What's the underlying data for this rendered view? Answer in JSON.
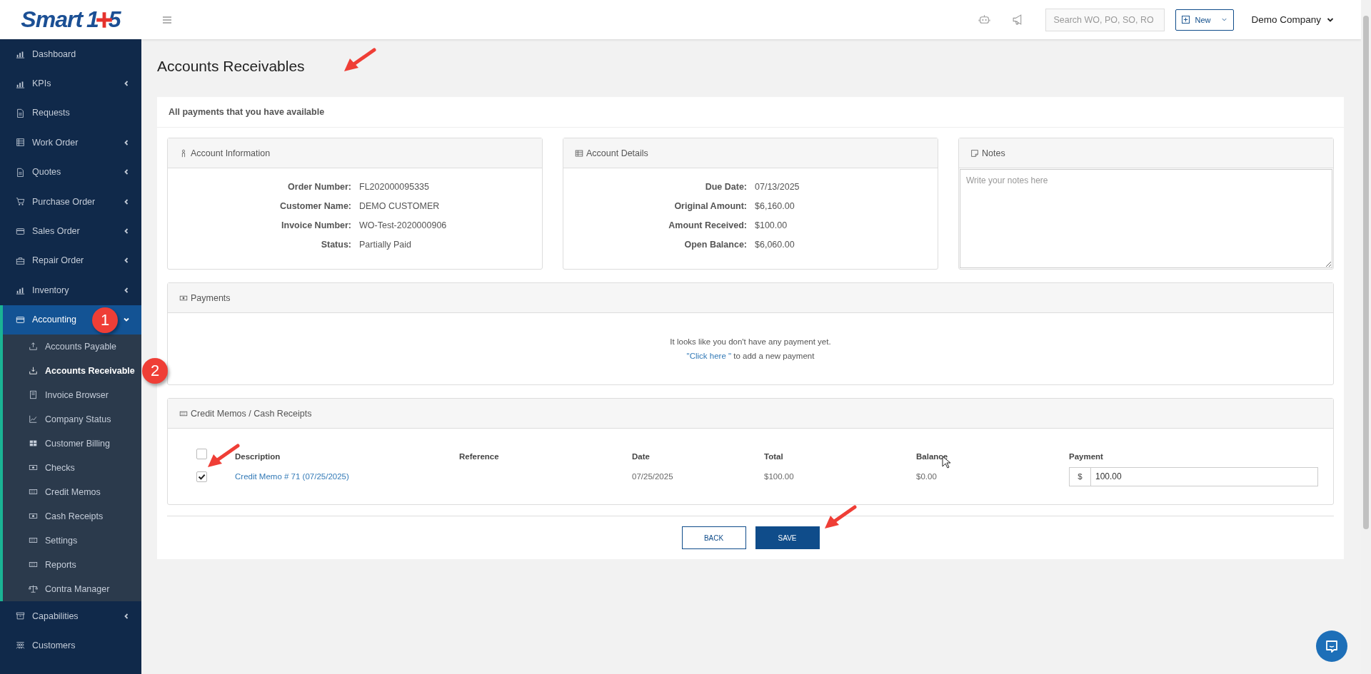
{
  "logo": {
    "word": "Smart",
    "digits": [
      "1",
      "5"
    ]
  },
  "topbar": {
    "search": {
      "placeholder": "Search WO, PO, SO, RO"
    },
    "new_button": {
      "label": "New"
    },
    "company_menu": {
      "label": "Demo Company"
    }
  },
  "sidebar": {
    "items": [
      {
        "label": "Dashboard",
        "kind": "link",
        "selected": false
      },
      {
        "label": "KPIs",
        "kind": "menu",
        "expanded": false,
        "selected": false
      },
      {
        "label": "Requests",
        "kind": "link",
        "selected": false
      },
      {
        "label": "Work Order",
        "kind": "menu",
        "expanded": false,
        "selected": false
      },
      {
        "label": "Quotes",
        "kind": "menu",
        "expanded": false,
        "selected": false
      },
      {
        "label": "Purchase Order",
        "kind": "menu",
        "expanded": false,
        "selected": false
      },
      {
        "label": "Sales Order",
        "kind": "menu",
        "expanded": false,
        "selected": false
      },
      {
        "label": "Repair Order",
        "kind": "menu",
        "expanded": false,
        "selected": false
      },
      {
        "label": "Inventory",
        "kind": "menu",
        "expanded": false,
        "selected": false
      },
      {
        "label": "Accounting",
        "kind": "menu",
        "expanded": true,
        "selected": true,
        "badge": "1",
        "children": [
          {
            "label": "Accounts Payable",
            "selected": false
          },
          {
            "label": "Accounts Receivable",
            "selected": true,
            "badge": "2"
          },
          {
            "label": "Invoice Browser",
            "selected": false
          },
          {
            "label": "Company Status",
            "selected": false
          },
          {
            "label": "Customer Billing",
            "selected": false
          },
          {
            "label": "Checks",
            "selected": false
          },
          {
            "label": "Credit Memos",
            "selected": false
          },
          {
            "label": "Cash Receipts",
            "selected": false
          },
          {
            "label": "Settings",
            "selected": false
          },
          {
            "label": "Reports",
            "selected": false
          },
          {
            "label": "Contra Manager",
            "selected": false
          }
        ]
      },
      {
        "label": "Capabilities",
        "kind": "menu",
        "expanded": false,
        "selected": false
      },
      {
        "label": "Customers",
        "kind": "link",
        "selected": false
      }
    ]
  },
  "page": {
    "title": "Accounts Receivables",
    "pointer_arrow": true
  },
  "panel": {
    "heading": "All payments that you have available",
    "account_information": {
      "title": "Account Information",
      "fields": [
        {
          "label": "Order Number:",
          "value": "FL202000095335"
        },
        {
          "label": "Customer Name:",
          "value": "DEMO CUSTOMER"
        },
        {
          "label": "Invoice Number:",
          "value": "WO-Test-2020000906"
        },
        {
          "label": "Status:",
          "value": "Partially Paid"
        }
      ]
    },
    "account_details": {
      "title": "Account Details",
      "fields": [
        {
          "label": "Due Date:",
          "value": "07/13/2025"
        },
        {
          "label": "Original Amount:",
          "value": "$6,160.00"
        },
        {
          "label": "Amount Received:",
          "value": "$100.00"
        },
        {
          "label": "Open Balance:",
          "value": "$6,060.00"
        }
      ]
    },
    "notes": {
      "title": "Notes",
      "placeholder": "Write your notes here"
    },
    "payments": {
      "title": "Payments",
      "empty_message": "It looks like you don't have any payment yet.",
      "add_link": "\"Click here \"",
      "add_text": " to add a new payment"
    },
    "credit_memos": {
      "title": "Credit Memos / Cash Receipts",
      "select_all": {
        "checked": false
      },
      "columns": [
        "Description",
        "Reference",
        "Date",
        "Total",
        "Balance",
        "Payment"
      ],
      "rows": [
        {
          "checked": true,
          "pointer_arrow": true,
          "description": "Credit Memo # 71 (07/25/2025)",
          "date": "07/25/2025",
          "total": "$100.00",
          "balance": "$0.00",
          "payment": {
            "currency": "$",
            "value": "100.00"
          }
        }
      ]
    },
    "buttons": [
      {
        "label": "BACK",
        "kind": "secondary"
      },
      {
        "label": "SAVE",
        "kind": "primary",
        "pointer_arrow": true
      }
    ]
  }
}
